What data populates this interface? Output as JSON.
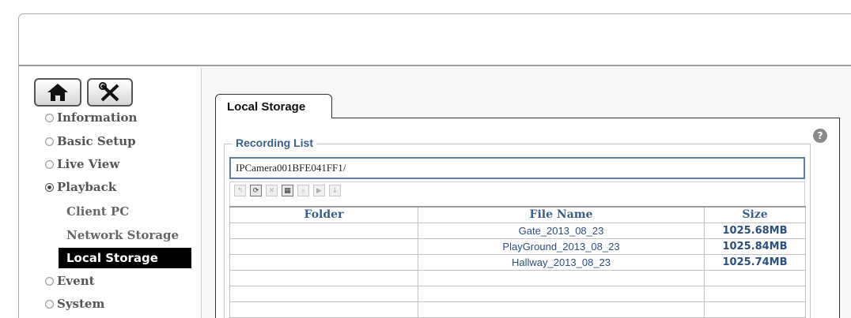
{
  "nav": {
    "items": [
      {
        "label": "Information",
        "selected": false
      },
      {
        "label": "Basic Setup",
        "selected": false
      },
      {
        "label": "Live View",
        "selected": false
      },
      {
        "label": "Playback",
        "selected": true
      },
      {
        "label": "Event",
        "selected": false
      },
      {
        "label": "System",
        "selected": false
      }
    ],
    "playback_sub": [
      "Client PC",
      "Network Storage",
      "Local Storage"
    ],
    "active_sub": "Local Storage"
  },
  "icons": {
    "home": "home-icon",
    "tools": "tools-icon",
    "help": "help-icon"
  },
  "tab": {
    "label": "Local Storage"
  },
  "recording": {
    "legend": "Recording List",
    "path": "IPCamera001BFE041FF1/"
  },
  "table": {
    "columns": [
      "Folder",
      "File Name",
      "Size"
    ],
    "rows": [
      {
        "folder": "",
        "file": "Gate_2013_08_23",
        "size": "1025.68MB"
      },
      {
        "folder": "",
        "file": "PlayGround_2013_08_23",
        "size": "1025.84MB"
      },
      {
        "folder": "",
        "file": "Hallway_2013_08_23",
        "size": "1025.74MB"
      },
      {
        "folder": "",
        "file": "",
        "size": ""
      },
      {
        "folder": "",
        "file": "",
        "size": ""
      },
      {
        "folder": "",
        "file": "",
        "size": ""
      },
      {
        "folder": "",
        "file": "",
        "size": ""
      }
    ]
  },
  "colors": {
    "accent": "#3a5f86",
    "active_nav_bg": "#000000"
  }
}
